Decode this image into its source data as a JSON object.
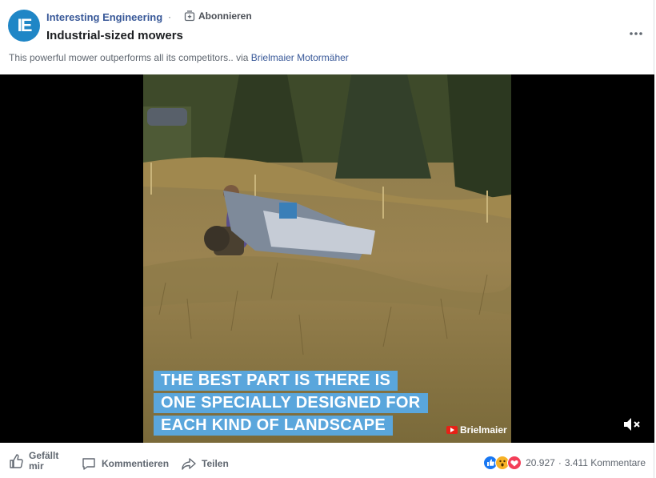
{
  "post": {
    "page_name": "Interesting Engineering",
    "avatar_text": "IE",
    "dot": "·",
    "subscribe_label": "Abonnieren",
    "title": "Industrial-sized mowers",
    "caption_text": "This powerful mower outperforms all its competitors.. via ",
    "caption_link": "Brielmaier Motormäher"
  },
  "video": {
    "overlay_lines": [
      "THE BEST PART IS THERE IS",
      "ONE SPECIALLY DESIGNED FOR",
      "EACH KIND OF LANDSCAPE"
    ],
    "watermark": "Brielmaier"
  },
  "actions": {
    "like_label": "Gefällt mir",
    "comment_label": "Kommentieren",
    "share_label": "Teilen"
  },
  "stats": {
    "reaction_count": "20.927",
    "separator": "·",
    "comments": "3.411 Kommentare"
  },
  "colors": {
    "brand": "#1f86c6",
    "link": "#385898",
    "overlay": "#5aa6dc"
  }
}
